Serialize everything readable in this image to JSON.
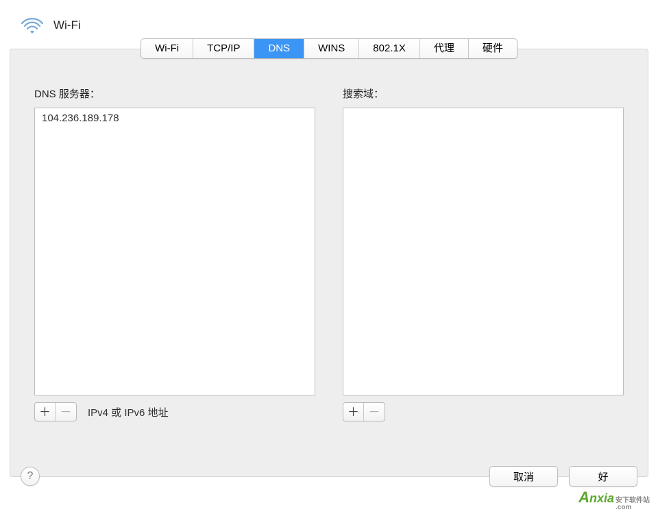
{
  "header": {
    "title": "Wi-Fi"
  },
  "tabs": [
    {
      "label": "Wi-Fi",
      "active": false
    },
    {
      "label": "TCP/IP",
      "active": false
    },
    {
      "label": "DNS",
      "active": true
    },
    {
      "label": "WINS",
      "active": false
    },
    {
      "label": "802.1X",
      "active": false
    },
    {
      "label": "代理",
      "active": false
    },
    {
      "label": "硬件",
      "active": false
    }
  ],
  "dns_panel": {
    "label": "DNS 服务器：",
    "servers": [
      "104.236.189.178"
    ],
    "add_symbol": "＋",
    "remove_symbol": "－",
    "hint": "IPv4 或 IPv6 地址"
  },
  "search_panel": {
    "label": "搜索域：",
    "domains": [],
    "add_symbol": "＋",
    "remove_symbol": "－"
  },
  "footer": {
    "help_symbol": "?",
    "cancel": "取消",
    "ok": "好"
  },
  "watermark": {
    "brand_a": "A",
    "brand_rest": "nxia",
    "cn": "安下软件站",
    "com": ".com"
  }
}
